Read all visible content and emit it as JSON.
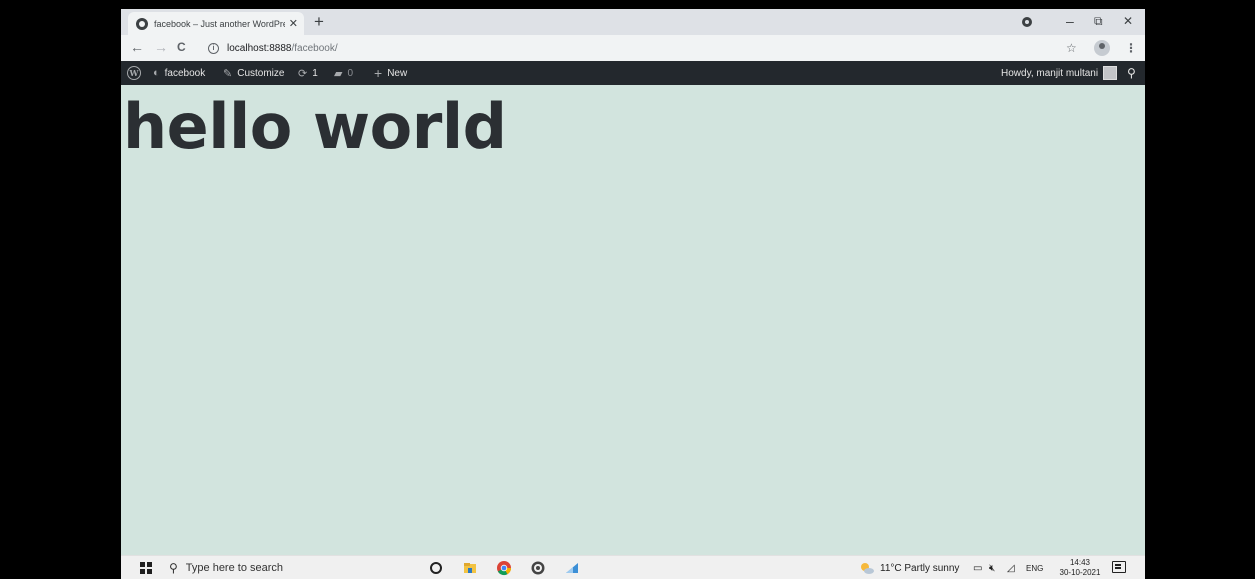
{
  "browser": {
    "tab_title": "facebook – Just another WordPre",
    "tab_close": "✕",
    "new_tab": "+",
    "window_controls": {
      "minimize": "–",
      "maximize": "⧉",
      "close": "✕"
    },
    "nav": {
      "back": "←",
      "forward": "→",
      "reload": "C"
    },
    "url_host": "localhost:8888",
    "url_path": "/facebook/",
    "bookmark_star": "☆",
    "menu": "⋮"
  },
  "adminbar": {
    "site_name": "facebook",
    "customize": "Customize",
    "updates_count": "1",
    "comments_count": "0",
    "new_label": "New",
    "howdy": "Howdy, manjit multani"
  },
  "page": {
    "heading": "hello world"
  },
  "taskbar": {
    "search_placeholder": "Type here to search",
    "weather": "11°C  Partly sunny",
    "language": "ENG",
    "time": "14:43",
    "date": "30-10-2021"
  }
}
